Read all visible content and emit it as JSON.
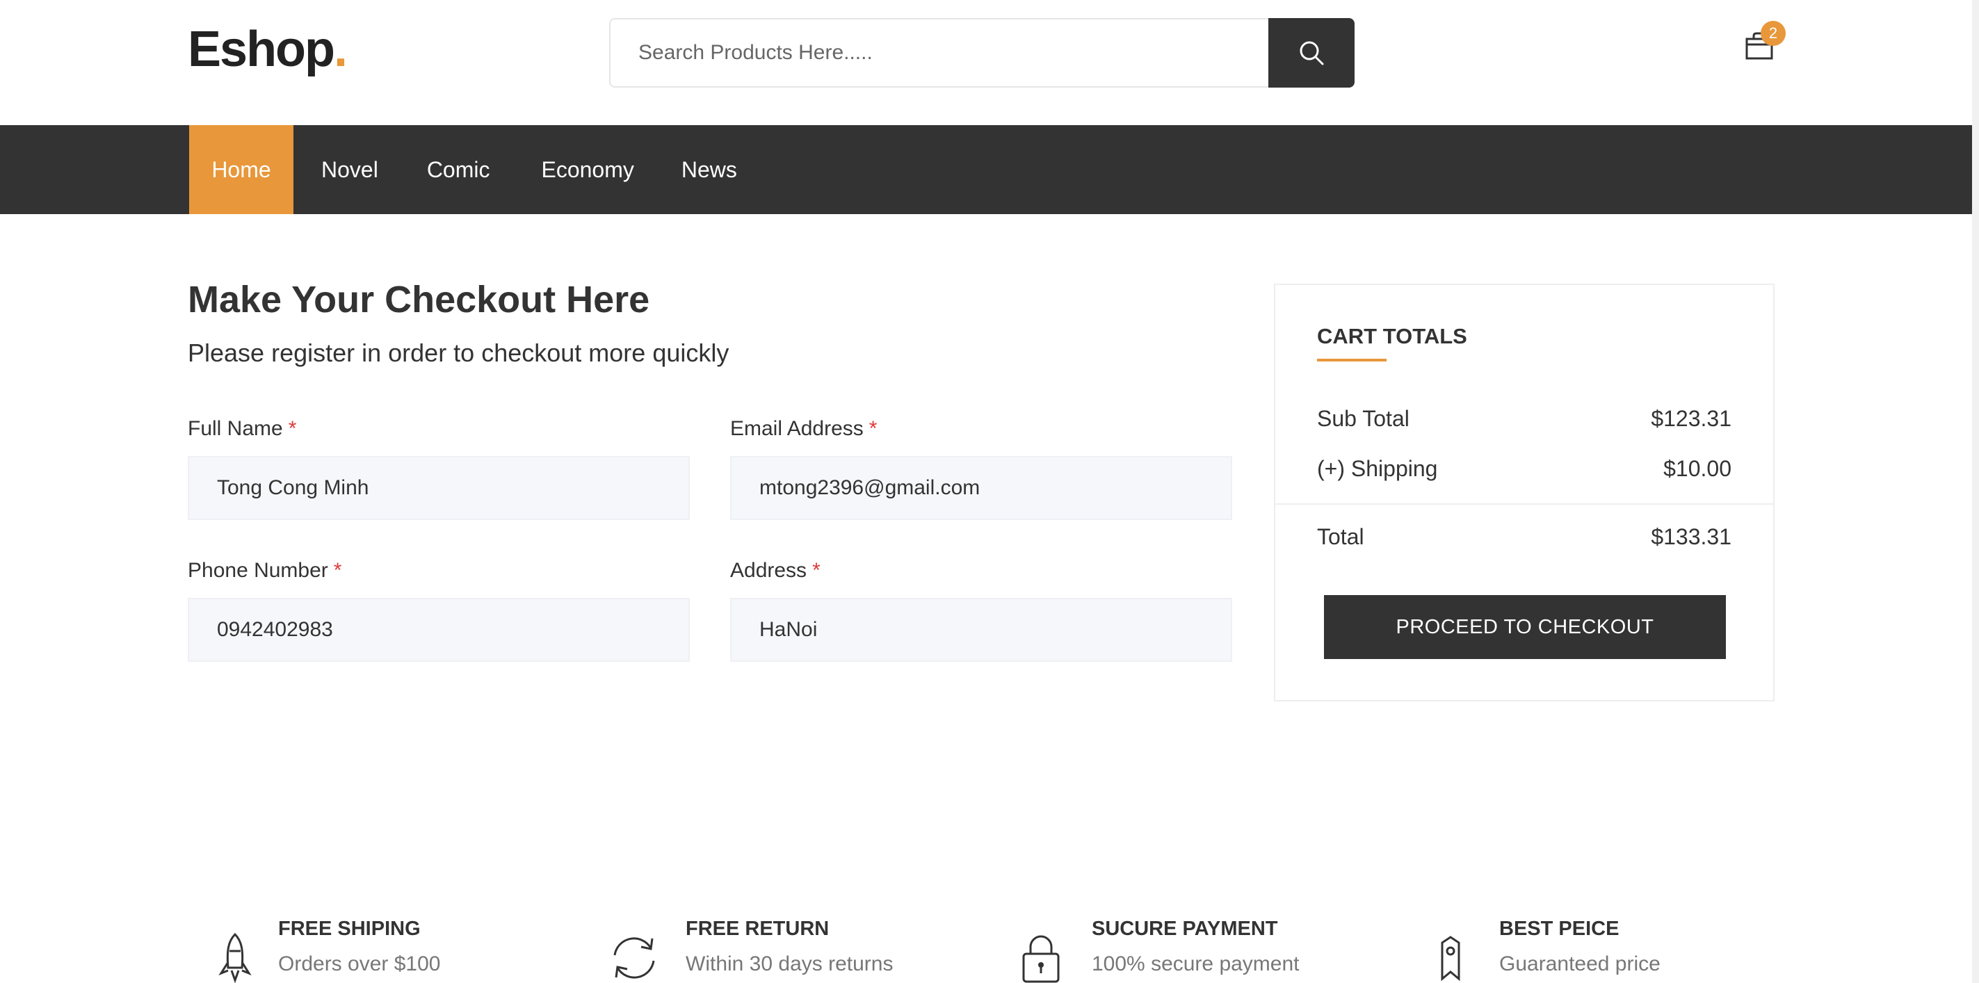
{
  "header": {
    "logo_text": "Eshop",
    "logo_dot": ".",
    "search_placeholder": "Search Products Here.....",
    "cart_count": "2"
  },
  "nav": {
    "items": [
      {
        "label": "Home",
        "active": true
      },
      {
        "label": "Novel"
      },
      {
        "label": "Comic"
      },
      {
        "label": "Economy"
      },
      {
        "label": "News"
      }
    ]
  },
  "checkout": {
    "title": "Make Your Checkout Here",
    "subtitle": "Please register in order to checkout more quickly",
    "required_mark": "*",
    "fields": {
      "full_name": {
        "label": "Full Name",
        "value": "Tong Cong Minh"
      },
      "email": {
        "label": "Email Address",
        "value": "mtong2396@gmail.com"
      },
      "phone": {
        "label": "Phone Number",
        "value": "0942402983"
      },
      "address": {
        "label": "Address",
        "value": "HaNoi"
      }
    }
  },
  "cart_totals": {
    "title": "CART TOTALS",
    "sub_total_label": "Sub Total",
    "sub_total_value": "$123.31",
    "shipping_label": "(+) Shipping",
    "shipping_value": "$10.00",
    "total_label": "Total",
    "total_value": "$133.31",
    "button_label": "PROCEED TO CHECKOUT"
  },
  "features": [
    {
      "icon": "rocket-icon",
      "title": "FREE SHIPING",
      "subtitle": "Orders over $100"
    },
    {
      "icon": "refresh-icon",
      "title": "FREE RETURN",
      "subtitle": "Within 30 days returns"
    },
    {
      "icon": "lock-icon",
      "title": "SUCURE PAYMENT",
      "subtitle": "100% secure payment"
    },
    {
      "icon": "tag-icon",
      "title": "BEST PEICE",
      "subtitle": "Guaranteed price"
    }
  ],
  "colors": {
    "accent": "#e8973a",
    "dark": "#333333",
    "input_bg": "#f6f7fb",
    "required": "#e03a3a"
  }
}
